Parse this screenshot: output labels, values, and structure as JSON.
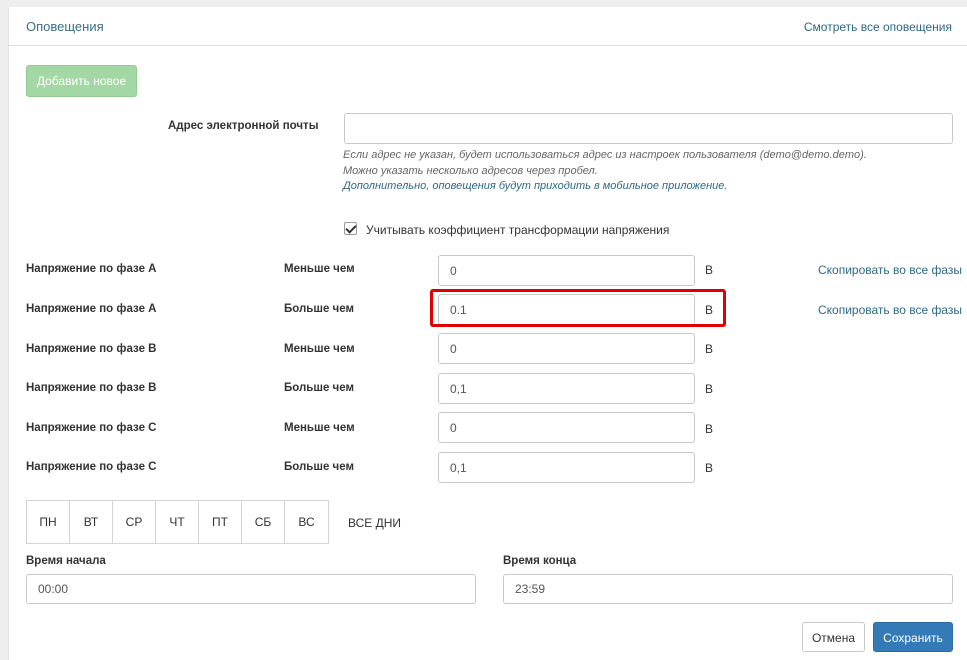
{
  "header": {
    "title": "Оповещения",
    "view_all_link": "Смотреть все оповещения"
  },
  "add_button": "Добавить новое",
  "email": {
    "label": "Адрес электронной почты",
    "value": "",
    "help_line1": "Если адрес не указан, будет использоваться адрес из настроек пользователя (demo@demo.demo).",
    "help_line2": "Можно указать несколько адресов через пробел.",
    "help_line3": "Дополнительно, оповещения будут приходить в мобильное приложение."
  },
  "transform_checkbox": {
    "label": "Учитывать коэффициент трансформации напряжения",
    "checked": true
  },
  "rows": [
    {
      "param": "Напряжение по фазе А",
      "condition": "Меньше чем",
      "value": "0",
      "unit": "В",
      "copy": "Скопировать во все фазы"
    },
    {
      "param": "Напряжение по фазе А",
      "condition": "Больше чем",
      "value": "0.1",
      "unit": "В",
      "copy": "Скопировать во все фазы"
    },
    {
      "param": "Напряжение по фазе B",
      "condition": "Меньше чем",
      "value": "0",
      "unit": "В"
    },
    {
      "param": "Напряжение по фазе B",
      "condition": "Больше чем",
      "value": "0,1",
      "unit": "В"
    },
    {
      "param": "Напряжение по фазе C",
      "condition": "Меньше чем",
      "value": "0",
      "unit": "В"
    },
    {
      "param": "Напряжение по фазе C",
      "condition": "Больше чем",
      "value": "0,1",
      "unit": "В"
    }
  ],
  "days": [
    "ПН",
    "ВТ",
    "СР",
    "ЧТ",
    "ПТ",
    "СБ",
    "ВС"
  ],
  "all_days": "ВСЕ ДНИ",
  "time": {
    "start_label": "Время начала",
    "start_value": "00:00",
    "end_label": "Время конца",
    "end_value": "23:59"
  },
  "buttons": {
    "cancel": "Отмена",
    "save": "Сохранить"
  },
  "colors": {
    "add_button": "#a3d7a3",
    "save_button": "#337ab7",
    "link": "#2d6987",
    "highlight": "#e00000"
  }
}
